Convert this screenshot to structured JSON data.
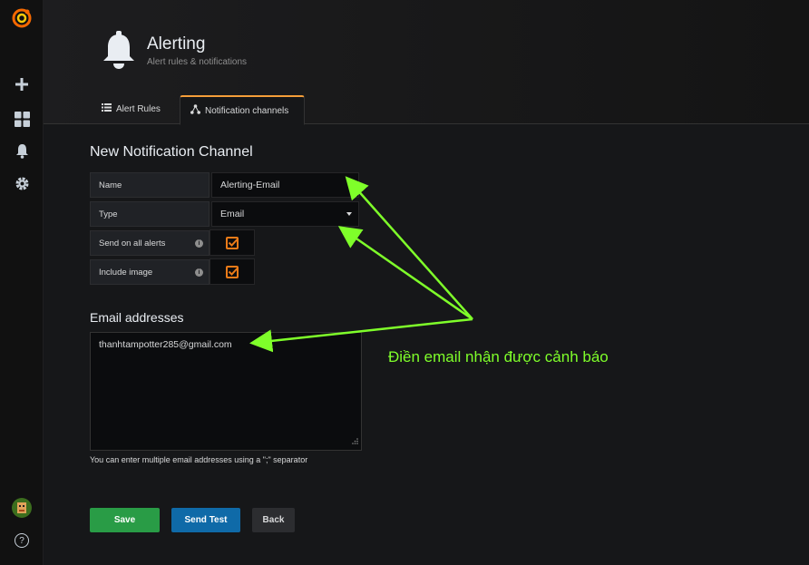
{
  "sidebar": {
    "items": [
      {
        "icon": "grafana-logo-icon"
      },
      {
        "icon": "plus-icon"
      },
      {
        "icon": "dashboards-icon"
      },
      {
        "icon": "bell-icon"
      },
      {
        "icon": "gear-icon"
      }
    ],
    "bottom": [
      {
        "icon": "avatar"
      },
      {
        "icon": "help-icon",
        "label": "?"
      }
    ]
  },
  "header": {
    "title": "Alerting",
    "subtitle": "Alert rules & notifications",
    "tabs": [
      {
        "label": "Alert Rules",
        "active": false
      },
      {
        "label": "Notification channels",
        "active": true
      }
    ]
  },
  "form": {
    "heading": "New Notification Channel",
    "fields": {
      "name": {
        "label": "Name",
        "value": "Alerting-Email"
      },
      "type": {
        "label": "Type",
        "value": "Email"
      },
      "send_all": {
        "label": "Send on all alerts",
        "checked": true
      },
      "include_image": {
        "label": "Include image",
        "checked": true
      }
    },
    "email": {
      "heading": "Email addresses",
      "value": "thanhtampotter285@gmail.com",
      "helper": "You can enter multiple email addresses using a \";\" separator"
    },
    "buttons": {
      "save": "Save",
      "send_test": "Send Test",
      "back": "Back"
    }
  },
  "annotation": {
    "text": "Điền email nhận được cảnh báo",
    "color": "#7fff2a"
  },
  "colors": {
    "accent_orange": "#eb7b18",
    "save_green": "#299c46",
    "send_test_blue": "#1f62e0",
    "tab_gradient": "#f59e39"
  }
}
